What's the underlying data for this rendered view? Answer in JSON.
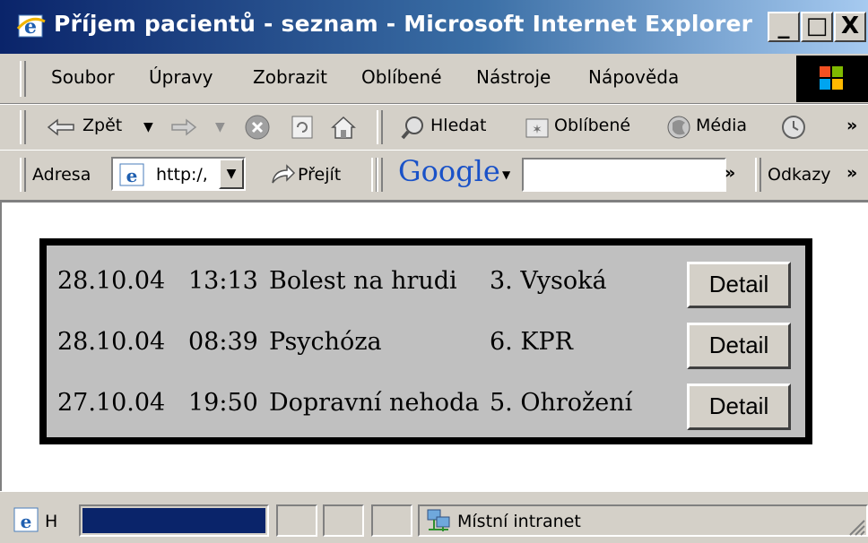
{
  "window": {
    "title": "Příjem pacientů - seznam - Microsoft Internet Explorer",
    "controls": {
      "minimize": "_",
      "maximize": "□",
      "close": "X"
    }
  },
  "menubar": {
    "items": [
      {
        "label": "Soubor"
      },
      {
        "label": "Úpravy"
      },
      {
        "label": "Zobrazit"
      },
      {
        "label": "Oblíbené"
      },
      {
        "label": "Nástroje"
      },
      {
        "label": "Nápověda"
      }
    ]
  },
  "toolbar": {
    "back": "Zpět",
    "search": "Hledat",
    "favorites": "Oblíbené",
    "media": "Média",
    "more": "»"
  },
  "addressbar": {
    "label": "Adresa",
    "url": "http:/,",
    "go": "Přejít",
    "google": "Google",
    "more": "»",
    "links": "Odkazy",
    "links_more": "»"
  },
  "patients": {
    "rows": [
      {
        "date": "28.10.04",
        "time": "13:13",
        "reason": "Bolest na hrudi",
        "priority": "3. Vysoká",
        "action": "Detail"
      },
      {
        "date": "28.10.04",
        "time": "08:39",
        "reason": "Psychóza",
        "priority": "6. KPR",
        "action": "Detail"
      },
      {
        "date": "27.10.04",
        "time": "19:50",
        "reason": "Dopravní nehoda",
        "priority": "5. Ohrožení",
        "action": "Detail"
      }
    ]
  },
  "statusbar": {
    "status_text": "H",
    "zone": "Místní intranet",
    "progress_percent": 100
  },
  "colors": {
    "titlebar_start": "#0a246a",
    "titlebar_end": "#a6caf0",
    "panel_border": "#000000",
    "panel_bg": "#c0c0c0",
    "progress": "#0a246a"
  }
}
